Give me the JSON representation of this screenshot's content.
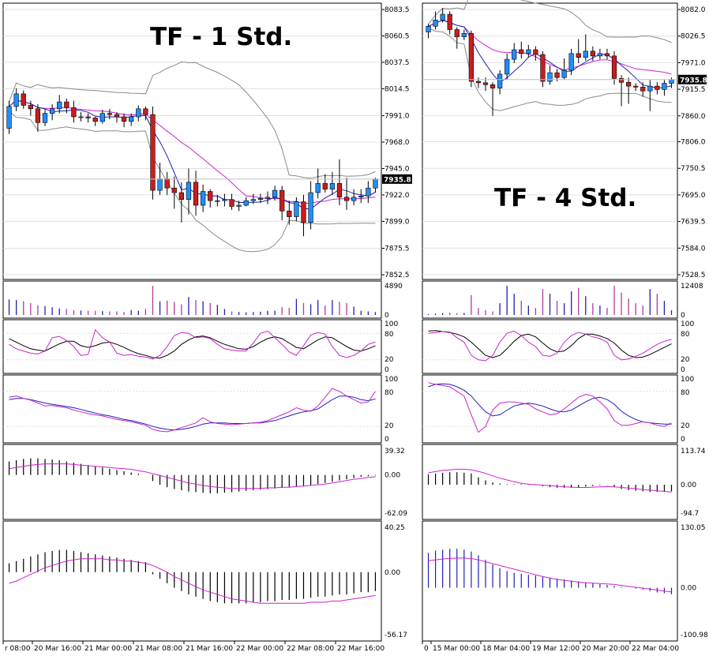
{
  "colors": {
    "up": "#1e90ff",
    "down": "#c81e1e",
    "ma_fast": "#1f1fb8",
    "ma_slow": "#cc22cc",
    "band": "#8a8a8a",
    "vol_buy": "#b03a9c",
    "vol_sell": "#1f1fb8",
    "osc_signal": "#000000",
    "grid": "#e0e0e0",
    "tag_bg": "#000000",
    "tag_fg": "#ffffff"
  },
  "chart_data": [
    {
      "type": "candlestick",
      "title": "TF - 1 Std.",
      "price_tag": "7935.8",
      "y_ticks": [
        "8083.5",
        "8060.5",
        "8037.5",
        "8014.5",
        "7991.0",
        "7968.0",
        "7945.0",
        "7922.0",
        "7899.0",
        "7875.5",
        "7852.5"
      ],
      "ylim": [
        7852.5,
        8083.5
      ],
      "x_ticks": [
        "r 08:00",
        "20 Mar 16:00",
        "21 Mar 00:00",
        "21 Mar 08:00",
        "21 Mar 16:00",
        "22 Mar 00:00",
        "22 Mar 08:00",
        "22 Mar 16:00"
      ],
      "candles": [
        [
          7980,
          7999,
          7975,
          8004
        ],
        [
          7999,
          8010,
          7995,
          8015
        ],
        [
          8010,
          8000,
          7997,
          8013
        ],
        [
          8000,
          7997,
          7991,
          8004
        ],
        [
          7997,
          7985,
          7977,
          8001
        ],
        [
          7985,
          7993,
          7982,
          7997
        ],
        [
          7993,
          7997,
          7987,
          8001
        ],
        [
          7997,
          8003,
          7993,
          8009
        ],
        [
          8003,
          7998,
          7993,
          8006
        ],
        [
          7998,
          7990,
          7985,
          8004
        ],
        [
          7990,
          7990,
          7986,
          7994
        ],
        [
          7990,
          7989,
          7985,
          7993
        ],
        [
          7989,
          7986,
          7982,
          7990
        ],
        [
          7986,
          7993,
          7984,
          7996
        ],
        [
          7993,
          7992,
          7988,
          7997
        ],
        [
          7992,
          7990,
          7985,
          7994
        ],
        [
          7990,
          7986,
          7981,
          7993
        ],
        [
          7986,
          7990,
          7982,
          7993
        ],
        [
          7990,
          7997,
          7986,
          8000
        ],
        [
          7997,
          7992,
          7987,
          7999
        ],
        [
          7992,
          7926,
          7918,
          7999
        ],
        [
          7926,
          7936,
          7922,
          7950
        ],
        [
          7936,
          7928,
          7922,
          7942
        ],
        [
          7928,
          7924,
          7910,
          7938
        ],
        [
          7924,
          7918,
          7898,
          7933
        ],
        [
          7918,
          7933,
          7905,
          7945
        ],
        [
          7933,
          7913,
          7904,
          7943
        ],
        [
          7913,
          7925,
          7907,
          7931
        ],
        [
          7925,
          7917,
          7911,
          7927
        ],
        [
          7917,
          7917,
          7912,
          7922
        ],
        [
          7917,
          7918,
          7912,
          7923
        ],
        [
          7918,
          7912,
          7909,
          7923
        ],
        [
          7912,
          7913,
          7908,
          7917
        ],
        [
          7913,
          7917,
          7912,
          7920
        ],
        [
          7917,
          7918,
          7914,
          7923
        ],
        [
          7918,
          7919,
          7915,
          7923
        ],
        [
          7919,
          7920,
          7914,
          7925
        ],
        [
          7920,
          7926,
          7917,
          7930
        ],
        [
          7926,
          7908,
          7900,
          7930
        ],
        [
          7908,
          7903,
          7896,
          7917
        ],
        [
          7903,
          7916,
          7899,
          7920
        ],
        [
          7916,
          7898,
          7886,
          7922
        ],
        [
          7898,
          7924,
          7892,
          7934
        ],
        [
          7924,
          7932,
          7919,
          7945
        ],
        [
          7932,
          7927,
          7924,
          7940
        ],
        [
          7927,
          7932,
          7922,
          7942
        ],
        [
          7932,
          7920,
          7913,
          7953
        ],
        [
          7920,
          7917,
          7909,
          7937
        ],
        [
          7917,
          7920,
          7913,
          7927
        ],
        [
          7920,
          7921,
          7915,
          7927
        ],
        [
          7921,
          7928,
          7915,
          7934
        ],
        [
          7928,
          7935.8,
          7924,
          7937
        ]
      ],
      "volume": [
        2600,
        2500,
        2300,
        2000,
        1600,
        1500,
        1300,
        1100,
        1000,
        800,
        750,
        700,
        700,
        650,
        600,
        600,
        500,
        800,
        700,
        1000,
        4890,
        2300,
        2400,
        2200,
        1800,
        3000,
        2500,
        2300,
        2000,
        1700,
        1000,
        600,
        500,
        450,
        500,
        550,
        700,
        700,
        1300,
        1200,
        2700,
        2000,
        1800,
        2500,
        1600,
        2500,
        2200,
        2000,
        1400,
        700,
        600,
        500
      ],
      "vol_labels": [
        "4890",
        "0"
      ],
      "osc_labels": [
        "100",
        "80",
        "20",
        "0"
      ],
      "sto1_k": [
        55,
        45,
        40,
        35,
        33,
        40,
        70,
        73,
        64,
        50,
        30,
        32,
        88,
        70,
        60,
        35,
        30,
        32,
        28,
        26,
        22,
        30,
        50,
        75,
        82,
        80,
        70,
        72,
        68,
        55,
        45,
        42,
        40,
        40,
        58,
        80,
        85,
        70,
        55,
        38,
        30,
        52,
        76,
        82,
        78,
        50,
        30,
        25,
        30,
        40,
        55,
        60
      ],
      "sto1_d": [
        68,
        60,
        52,
        45,
        42,
        40,
        48,
        56,
        62,
        62,
        52,
        48,
        52,
        58,
        60,
        55,
        48,
        40,
        34,
        30,
        25,
        24,
        30,
        40,
        55,
        65,
        72,
        74,
        70,
        62,
        55,
        50,
        45,
        44,
        50,
        60,
        68,
        72,
        68,
        58,
        48,
        45,
        55,
        65,
        72,
        70,
        60,
        50,
        42,
        40,
        45,
        52
      ],
      "sto2_k": [
        70,
        72,
        68,
        65,
        60,
        55,
        56,
        54,
        52,
        48,
        45,
        42,
        40,
        38,
        35,
        32,
        30,
        28,
        25,
        22,
        15,
        12,
        11,
        14,
        18,
        22,
        26,
        35,
        28,
        25,
        24,
        23,
        24,
        25,
        26,
        27,
        30,
        35,
        40,
        45,
        52,
        48,
        46,
        55,
        70,
        85,
        80,
        72,
        66,
        60,
        62,
        80
      ],
      "sto2_d": [
        66,
        68,
        68,
        66,
        63,
        60,
        58,
        56,
        54,
        52,
        49,
        46,
        43,
        40,
        38,
        35,
        32,
        30,
        27,
        24,
        20,
        17,
        15,
        14,
        15,
        17,
        20,
        24,
        26,
        26,
        26,
        25,
        25,
        25,
        26,
        26,
        28,
        30,
        34,
        38,
        42,
        45,
        47,
        50,
        58,
        66,
        72,
        72,
        70,
        66,
        64,
        67
      ],
      "macd1_hist": [
        22,
        24,
        26,
        27,
        27,
        26,
        25,
        24,
        22,
        20,
        18,
        16,
        14,
        12,
        10,
        8,
        6,
        4,
        2,
        0,
        -10,
        -16,
        -20,
        -23,
        -25,
        -27,
        -28,
        -29,
        -30,
        -30,
        -29,
        -28,
        -27,
        -26,
        -25,
        -24,
        -23,
        -22,
        -21,
        -20,
        -19,
        -18,
        -17,
        -15,
        -13,
        -11,
        -9,
        -7,
        -5,
        -3,
        -2,
        -1
      ],
      "macd1_sig": [
        10,
        12,
        14,
        16,
        17,
        18,
        18,
        18,
        18,
        17,
        16,
        15,
        14,
        13,
        12,
        11,
        10,
        9,
        7,
        5,
        2,
        -1,
        -4,
        -7,
        -10,
        -13,
        -15,
        -17,
        -19,
        -20,
        -21,
        -22,
        -22,
        -22,
        -22,
        -22,
        -21,
        -21,
        -20,
        -20,
        -19,
        -18,
        -17,
        -16,
        -15,
        -13,
        -11,
        -9,
        -7,
        -6,
        -4,
        -3
      ],
      "macd1_labels": [
        "39.32",
        "0.00",
        "-62.09"
      ],
      "macd2_hist": [
        8,
        10,
        12,
        14,
        16,
        18,
        19,
        20,
        20,
        19,
        18,
        17,
        16,
        15,
        14,
        13,
        12,
        11,
        10,
        9,
        -2,
        -6,
        -10,
        -14,
        -17,
        -20,
        -22,
        -24,
        -26,
        -27,
        -28,
        -28,
        -28,
        -28,
        -27,
        -27,
        -26,
        -26,
        -25,
        -25,
        -24,
        -24,
        -23,
        -22,
        -22,
        -21,
        -20,
        -20,
        -19,
        -18,
        -18,
        -17
      ],
      "macd2_sig": [
        -10,
        -8,
        -5,
        -2,
        1,
        4,
        6,
        8,
        10,
        11,
        12,
        12,
        12,
        12,
        11,
        11,
        10,
        10,
        9,
        8,
        6,
        3,
        0,
        -4,
        -7,
        -10,
        -13,
        -16,
        -18,
        -20,
        -22,
        -24,
        -25,
        -26,
        -27,
        -28,
        -28,
        -28,
        -28,
        -28,
        -28,
        -28,
        -27,
        -27,
        -27,
        -26,
        -26,
        -25,
        -24,
        -23,
        -22,
        -21
      ],
      "macd2_labels": [
        "40.25",
        "0.00",
        "-56.17"
      ]
    },
    {
      "type": "candlestick",
      "title": "TF - 4 Std.",
      "price_tag": "7935.8",
      "y_ticks": [
        "8082.0",
        "8026.5",
        "7971.0",
        "7915.5",
        "7860.0",
        "7806.0",
        "7750.5",
        "7695.0",
        "7639.5",
        "7584.0",
        "7528.5"
      ],
      "ylim": [
        7528.5,
        8082.0
      ],
      "x_ticks": [
        "0",
        "15 Mar 00:00",
        "18 Mar 04:00",
        "19 Mar 12:00",
        "20 Mar 20:00",
        "22 Mar 04:00"
      ],
      "candles": [
        [
          8035,
          8047,
          8022,
          8052
        ],
        [
          8047,
          8060,
          8040,
          8078
        ],
        [
          8060,
          8072,
          8055,
          8085
        ],
        [
          8072,
          8040,
          8030,
          8078
        ],
        [
          8040,
          8025,
          8000,
          8045
        ],
        [
          8025,
          8032,
          8018,
          8040
        ],
        [
          8032,
          7932,
          7920,
          8038
        ],
        [
          7932,
          7929,
          7918,
          7940
        ],
        [
          7929,
          7925,
          7912,
          7940
        ],
        [
          7925,
          7918,
          7860,
          7930
        ],
        [
          7918,
          7947,
          7905,
          7955
        ],
        [
          7947,
          7978,
          7936,
          7990
        ],
        [
          7978,
          7998,
          7970,
          8012
        ],
        [
          7998,
          7990,
          7980,
          8015
        ],
        [
          7990,
          7998,
          7982,
          8008
        ],
        [
          7998,
          7988,
          7975,
          8005
        ],
        [
          7988,
          7932,
          7920,
          7995
        ],
        [
          7932,
          7950,
          7925,
          7965
        ],
        [
          7950,
          7940,
          7932,
          7958
        ],
        [
          7940,
          7955,
          7935,
          7980
        ],
        [
          7955,
          7990,
          7945,
          8000
        ],
        [
          7990,
          7982,
          7970,
          8020
        ],
        [
          7982,
          7995,
          7975,
          8030
        ],
        [
          7995,
          7985,
          7975,
          8005
        ],
        [
          7985,
          7990,
          7978,
          8000
        ],
        [
          7990,
          7985,
          7978,
          8000
        ],
        [
          7985,
          7938,
          7925,
          7995
        ],
        [
          7938,
          7930,
          7880,
          7945
        ],
        [
          7930,
          7922,
          7885,
          7940
        ],
        [
          7922,
          7920,
          7912,
          7928
        ],
        [
          7920,
          7912,
          7900,
          7930
        ],
        [
          7912,
          7922,
          7870,
          7935
        ],
        [
          7922,
          7915,
          7905,
          7930
        ],
        [
          7915,
          7928,
          7902,
          7935
        ],
        [
          7928,
          7935.8,
          7918,
          7940
        ]
      ],
      "volume": [
        400,
        600,
        800,
        1000,
        700,
        900,
        8500,
        3000,
        2000,
        1500,
        5000,
        12400,
        9000,
        6000,
        4000,
        3000,
        11000,
        9000,
        6000,
        5000,
        10000,
        11500,
        8000,
        5000,
        4000,
        3000,
        12408,
        9500,
        7000,
        5000,
        4000,
        11000,
        9000,
        6000,
        2000
      ],
      "vol_labels": [
        "12408",
        "0"
      ],
      "osc_labels": [
        "100",
        "80",
        "20",
        "0"
      ],
      "sto1_k": [
        80,
        82,
        84,
        83,
        70,
        60,
        30,
        20,
        18,
        30,
        60,
        80,
        85,
        75,
        60,
        50,
        30,
        28,
        35,
        60,
        75,
        82,
        78,
        72,
        68,
        60,
        30,
        20,
        22,
        28,
        35,
        45,
        55,
        62,
        66
      ],
      "sto1_d": [
        85,
        86,
        84,
        82,
        78,
        72,
        60,
        45,
        30,
        25,
        30,
        45,
        62,
        75,
        78,
        72,
        58,
        45,
        38,
        40,
        52,
        68,
        78,
        78,
        74,
        68,
        58,
        42,
        30,
        25,
        26,
        32,
        40,
        48,
        56
      ],
      "sto2_k": [
        95,
        92,
        90,
        88,
        80,
        72,
        40,
        10,
        20,
        48,
        60,
        62,
        62,
        60,
        58,
        50,
        45,
        40,
        42,
        50,
        60,
        70,
        75,
        72,
        62,
        50,
        30,
        22,
        22,
        25,
        28,
        26,
        22,
        20,
        26
      ],
      "sto2_d": [
        88,
        92,
        93,
        92,
        88,
        82,
        72,
        58,
        45,
        38,
        40,
        48,
        55,
        58,
        60,
        58,
        55,
        50,
        46,
        45,
        48,
        55,
        62,
        68,
        70,
        66,
        58,
        46,
        38,
        32,
        28,
        26,
        25,
        24,
        24
      ],
      "macd1_hist": [
        35,
        38,
        40,
        42,
        42,
        40,
        38,
        25,
        15,
        8,
        4,
        2,
        2,
        2,
        2,
        2,
        -5,
        -8,
        -10,
        -10,
        -10,
        -8,
        -6,
        -4,
        -2,
        -1,
        -8,
        -14,
        -18,
        -20,
        -22,
        -24,
        -24,
        -24,
        -22
      ],
      "macd1_sig": [
        40,
        44,
        48,
        50,
        52,
        52,
        50,
        45,
        38,
        30,
        22,
        16,
        10,
        5,
        2,
        0,
        -1,
        -3,
        -5,
        -7,
        -8,
        -9,
        -9,
        -8,
        -7,
        -6,
        -7,
        -9,
        -11,
        -13,
        -16,
        -18,
        -20,
        -22,
        -24
      ],
      "macd1_labels": [
        "113.74",
        "0.00",
        "-94.7"
      ],
      "macd2_hist": [
        75,
        80,
        82,
        84,
        84,
        82,
        78,
        70,
        60,
        50,
        42,
        36,
        32,
        30,
        28,
        26,
        24,
        22,
        20,
        18,
        16,
        14,
        12,
        10,
        8,
        6,
        4,
        2,
        0,
        -2,
        -4,
        -7,
        -10,
        -12,
        -14
      ],
      "macd2_sig": [
        58,
        60,
        62,
        63,
        64,
        64,
        63,
        60,
        56,
        52,
        48,
        44,
        40,
        36,
        32,
        28,
        24,
        21,
        18,
        16,
        14,
        12,
        11,
        10,
        9,
        8,
        7,
        5,
        3,
        1,
        -1,
        -3,
        -5,
        -7,
        -9
      ],
      "macd2_labels": [
        "130.05",
        "0.00",
        "-100.98"
      ]
    }
  ]
}
